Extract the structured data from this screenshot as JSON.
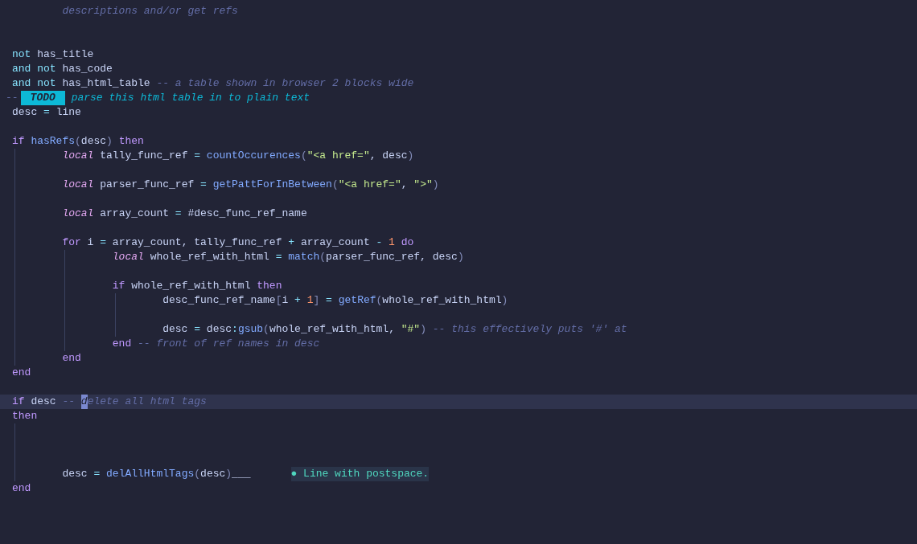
{
  "editor": {
    "lines": [
      {
        "kind": "continuation",
        "tokens": [
          {
            "kind": "cmt",
            "text": "descriptions and/or get refs"
          }
        ]
      },
      {
        "kind": "blank"
      },
      {
        "kind": "blank"
      },
      {
        "kind": "code",
        "tokens": [
          {
            "kind": "op",
            "text": "not"
          },
          {
            "kind": "var",
            "text": " has_title"
          }
        ]
      },
      {
        "kind": "code",
        "tokens": [
          {
            "kind": "op",
            "text": "and not"
          },
          {
            "kind": "var",
            "text": " has_code"
          }
        ]
      },
      {
        "kind": "code",
        "tokens": [
          {
            "kind": "op",
            "text": "and not"
          },
          {
            "kind": "var",
            "text": " has_html_table"
          },
          {
            "kind": "cmt",
            "text": " -- a table shown in browser 2 blocks wide"
          }
        ]
      },
      {
        "kind": "annotation",
        "tokens": [
          {
            "kind": "cmt",
            "text": "--"
          },
          {
            "kind": "todo",
            "text": "TODO"
          },
          {
            "kind": "todotext",
            "text": " parse this html table in to plain text"
          }
        ]
      },
      {
        "kind": "code",
        "tokens": [
          {
            "kind": "var",
            "text": "desc"
          },
          {
            "kind": "op",
            "text": " ="
          },
          {
            "kind": "var",
            "text": " line"
          }
        ]
      },
      {
        "kind": "blank"
      },
      {
        "kind": "code",
        "tokens": [
          {
            "kind": "kw",
            "text": "if"
          },
          {
            "kind": "fn",
            "text": " hasRefs"
          },
          {
            "kind": "punct",
            "text": "("
          },
          {
            "kind": "var",
            "text": "desc"
          },
          {
            "kind": "punct",
            "text": ")"
          },
          {
            "kind": "kw",
            "text": " then"
          }
        ],
        "children": [
          {
            "kind": "code",
            "tokens": [
              {
                "kind": "kwi",
                "text": "local"
              },
              {
                "kind": "var",
                "text": " tally_func_ref"
              },
              {
                "kind": "op",
                "text": " ="
              },
              {
                "kind": "fn",
                "text": " countOccurences"
              },
              {
                "kind": "punct",
                "text": "("
              },
              {
                "kind": "str",
                "text": "\"<a href=\""
              },
              {
                "kind": "var",
                "text": ", desc"
              },
              {
                "kind": "punct",
                "text": ")"
              }
            ]
          },
          {
            "kind": "blank"
          },
          {
            "kind": "code",
            "tokens": [
              {
                "kind": "kwi",
                "text": "local"
              },
              {
                "kind": "var",
                "text": " parser_func_ref"
              },
              {
                "kind": "op",
                "text": " ="
              },
              {
                "kind": "fn",
                "text": " getPattForInBetween"
              },
              {
                "kind": "punct",
                "text": "("
              },
              {
                "kind": "str",
                "text": "\"<a href=\""
              },
              {
                "kind": "var",
                "text": ","
              },
              {
                "kind": "str",
                "text": " \">\""
              },
              {
                "kind": "punct",
                "text": ")"
              }
            ]
          },
          {
            "kind": "blank"
          },
          {
            "kind": "code",
            "tokens": [
              {
                "kind": "kwi",
                "text": "local"
              },
              {
                "kind": "var",
                "text": " array_count"
              },
              {
                "kind": "op",
                "text": " ="
              },
              {
                "kind": "var",
                "text": " #desc_func_ref_name"
              }
            ]
          },
          {
            "kind": "blank"
          },
          {
            "kind": "code",
            "tokens": [
              {
                "kind": "kw",
                "text": "for"
              },
              {
                "kind": "var",
                "text": " i"
              },
              {
                "kind": "op",
                "text": " ="
              },
              {
                "kind": "var",
                "text": " array_count, tally_func_ref"
              },
              {
                "kind": "op",
                "text": " +"
              },
              {
                "kind": "var",
                "text": " array_count"
              },
              {
                "kind": "op",
                "text": " -"
              },
              {
                "kind": "num",
                "text": " 1"
              },
              {
                "kind": "kw",
                "text": " do"
              }
            ],
            "children": [
              {
                "kind": "code",
                "tokens": [
                  {
                    "kind": "kwi",
                    "text": "local"
                  },
                  {
                    "kind": "var",
                    "text": " whole_ref_with_html"
                  },
                  {
                    "kind": "op",
                    "text": " ="
                  },
                  {
                    "kind": "fn",
                    "text": " match"
                  },
                  {
                    "kind": "punct",
                    "text": "("
                  },
                  {
                    "kind": "var",
                    "text": "parser_func_ref, desc"
                  },
                  {
                    "kind": "punct",
                    "text": ")"
                  }
                ]
              },
              {
                "kind": "blank"
              },
              {
                "kind": "code",
                "tokens": [
                  {
                    "kind": "kw",
                    "text": "if"
                  },
                  {
                    "kind": "var",
                    "text": " whole_ref_with_html"
                  },
                  {
                    "kind": "kw",
                    "text": " then"
                  }
                ],
                "children": [
                  {
                    "kind": "code",
                    "tokens": [
                      {
                        "kind": "var",
                        "text": "desc_func_ref_name"
                      },
                      {
                        "kind": "punct",
                        "text": "["
                      },
                      {
                        "kind": "var",
                        "text": "i"
                      },
                      {
                        "kind": "op",
                        "text": " +"
                      },
                      {
                        "kind": "num",
                        "text": " 1"
                      },
                      {
                        "kind": "punct",
                        "text": "]"
                      },
                      {
                        "kind": "op",
                        "text": " ="
                      },
                      {
                        "kind": "fn",
                        "text": " getRef"
                      },
                      {
                        "kind": "punct",
                        "text": "("
                      },
                      {
                        "kind": "var",
                        "text": "whole_ref_with_html"
                      },
                      {
                        "kind": "punct",
                        "text": ")"
                      }
                    ]
                  },
                  {
                    "kind": "blank"
                  },
                  {
                    "kind": "code",
                    "tokens": [
                      {
                        "kind": "var",
                        "text": "desc"
                      },
                      {
                        "kind": "op",
                        "text": " ="
                      },
                      {
                        "kind": "var",
                        "text": " desc"
                      },
                      {
                        "kind": "op",
                        "text": ":"
                      },
                      {
                        "kind": "fn",
                        "text": "gsub"
                      },
                      {
                        "kind": "punct",
                        "text": "("
                      },
                      {
                        "kind": "var",
                        "text": "whole_ref_with_html,"
                      },
                      {
                        "kind": "str",
                        "text": " \"#\""
                      },
                      {
                        "kind": "punct",
                        "text": ")"
                      },
                      {
                        "kind": "cmt",
                        "text": " -- this effectively puts '#' at"
                      }
                    ]
                  }
                ]
              },
              {
                "kind": "code",
                "tokens": [
                  {
                    "kind": "kw",
                    "text": "end"
                  },
                  {
                    "kind": "cmt",
                    "text": " -- front of ref names in desc"
                  }
                ]
              }
            ]
          },
          {
            "kind": "code",
            "tokens": [
              {
                "kind": "kw",
                "text": "end"
              }
            ]
          }
        ]
      },
      {
        "kind": "code",
        "tokens": [
          {
            "kind": "kw",
            "text": "end"
          }
        ]
      },
      {
        "kind": "blank"
      },
      {
        "kind": "code",
        "current": true,
        "tokens": [
          {
            "kind": "kw",
            "text": "if"
          },
          {
            "kind": "var",
            "text": " desc"
          },
          {
            "kind": "cmt",
            "text": " -- "
          },
          {
            "kind": "cursor",
            "text": "d"
          },
          {
            "kind": "cmt",
            "text": "elete all html tags"
          }
        ]
      },
      {
        "kind": "code",
        "tokens": [
          {
            "kind": "kw",
            "text": "then"
          }
        ],
        "children": [
          {
            "kind": "blank"
          },
          {
            "kind": "blank"
          },
          {
            "kind": "blank"
          },
          {
            "kind": "code",
            "tokens": [
              {
                "kind": "var",
                "text": "desc"
              },
              {
                "kind": "op",
                "text": " ="
              },
              {
                "kind": "fn",
                "text": " delAllHtmlTags"
              },
              {
                "kind": "punct",
                "text": "("
              },
              {
                "kind": "var",
                "text": "desc"
              },
              {
                "kind": "punct",
                "text": ")"
              },
              {
                "kind": "var",
                "text": "___"
              }
            ],
            "diagnostic": "● Line with postspace."
          }
        ]
      },
      {
        "kind": "code",
        "tokens": [
          {
            "kind": "kw",
            "text": "end"
          }
        ]
      }
    ]
  }
}
